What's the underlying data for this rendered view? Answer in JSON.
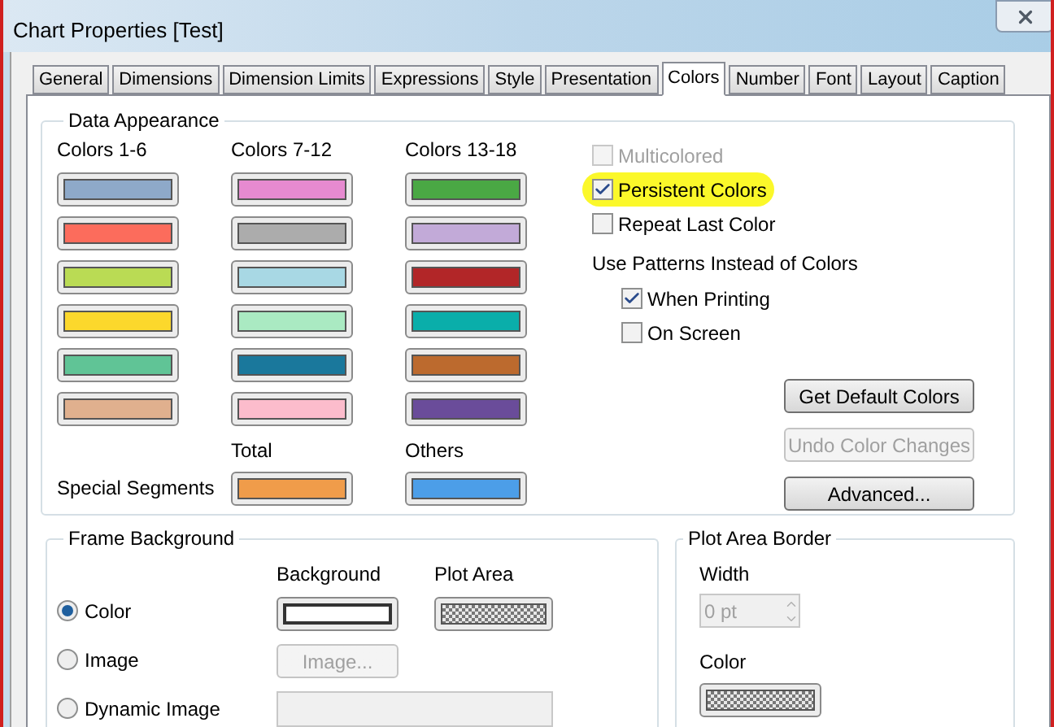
{
  "window": {
    "title": "Chart Properties [Test]"
  },
  "tabs": [
    {
      "label": "General",
      "selected": false
    },
    {
      "label": "Dimensions",
      "selected": false
    },
    {
      "label": "Dimension Limits",
      "selected": false
    },
    {
      "label": "Expressions",
      "selected": false
    },
    {
      "label": "Style",
      "selected": false
    },
    {
      "label": "Presentation",
      "selected": false
    },
    {
      "label": "Colors",
      "selected": true
    },
    {
      "label": "Number",
      "selected": false
    },
    {
      "label": "Font",
      "selected": false
    },
    {
      "label": "Layout",
      "selected": false
    },
    {
      "label": "Caption",
      "selected": false
    }
  ],
  "data_appearance": {
    "title": "Data Appearance",
    "columns": [
      {
        "heading": "Colors 1-6",
        "swatches": [
          {
            "color": "#8ea9c9"
          },
          {
            "color": "#fc6c5c"
          },
          {
            "color": "#badb54"
          },
          {
            "color": "#fcd82c"
          },
          {
            "color": "#60c496"
          },
          {
            "color": "#e0b08e"
          }
        ]
      },
      {
        "heading": "Colors 7-12",
        "swatches": [
          {
            "color": "#e68ad0"
          },
          {
            "color": "#acacac"
          },
          {
            "color": "#a8d8e4"
          },
          {
            "color": "#aaeac2"
          },
          {
            "color": "#1a789c"
          },
          {
            "color": "#fcbccc"
          }
        ]
      },
      {
        "heading": "Colors 13-18",
        "swatches": [
          {
            "color": "#4aa844"
          },
          {
            "color": "#c2aad8"
          },
          {
            "color": "#b22628"
          },
          {
            "color": "#0aaeaa"
          },
          {
            "color": "#bc6a2e"
          },
          {
            "color": "#6a4c9a"
          }
        ]
      }
    ],
    "special_segments": {
      "label": "Special Segments",
      "items": [
        {
          "label": "Total",
          "color": "#f09c4a"
        },
        {
          "label": "Others",
          "color": "#4c9ee8"
        }
      ]
    },
    "options": [
      {
        "label": "Multicolored",
        "checked": false,
        "disabled": true,
        "highlighted": false
      },
      {
        "label": "Persistent Colors",
        "checked": true,
        "disabled": false,
        "highlighted": true
      },
      {
        "label": "Repeat Last Color",
        "checked": false,
        "disabled": false,
        "highlighted": false
      }
    ],
    "patterns": {
      "label": "Use Patterns Instead of Colors",
      "options": [
        {
          "label": "When Printing",
          "checked": true
        },
        {
          "label": "On Screen",
          "checked": false
        }
      ]
    },
    "buttons": [
      {
        "label": "Get Default Colors",
        "disabled": false
      },
      {
        "label": "Undo Color Changes",
        "disabled": true
      },
      {
        "label": "Advanced...",
        "disabled": false
      }
    ]
  },
  "frame_background": {
    "title": "Frame Background",
    "background_heading": "Background",
    "plot_area_heading": "Plot Area",
    "options": [
      {
        "label": "Color",
        "selected": true
      },
      {
        "label": "Image",
        "selected": false
      },
      {
        "label": "Dynamic Image",
        "selected": false
      }
    ],
    "image_button": {
      "label": "Image...",
      "disabled": true
    }
  },
  "plot_area_border": {
    "title": "Plot Area Border",
    "width_label": "Width",
    "width_value": "0 pt",
    "color_label": "Color"
  }
}
